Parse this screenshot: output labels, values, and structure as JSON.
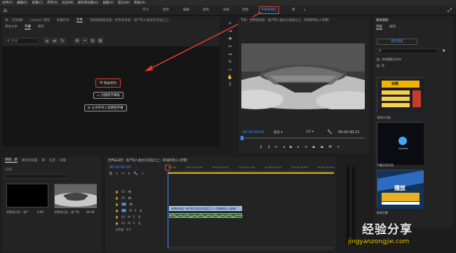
{
  "menu": [
    "文件(F)",
    "编辑(E)",
    "剪辑(C)",
    "序列(S)",
    "标记(M)",
    "图形和标题(G)",
    "视图(V)",
    "窗口(W)",
    "帮助(H)"
  ],
  "workspaces": [
    "学习",
    "组件",
    "编辑",
    "颜色",
    "效果",
    "音频",
    "字幕和图形",
    "库"
  ],
  "workspace_active": "字幕和图形",
  "source_panel": {
    "tabs": [
      "源：(无剪辑)",
      "Lumetri 范围",
      "效果控件",
      "文本",
      "音频剪辑混合器：世界末日后：丧尸的人类主在云层之上；"
    ],
    "sub_tabs": [
      "转录文本",
      "字幕",
      "图形"
    ],
    "sub_active": "字幕",
    "search_placeholder": "搜索",
    "buttons": [
      "转录序列",
      "创建新字幕轨",
      "从文件导入说明性字幕"
    ]
  },
  "program": {
    "title": "节目：世界末日后：丧尸的人类主在云层之上；可再移到让人恐惧！",
    "timecode": "00:00:00:00",
    "fit": "适合",
    "ratio": "1/2",
    "duration": "00:00:40:21"
  },
  "graphics_panel": {
    "title": "基本图形",
    "tabs": [
      "浏览",
      "编辑"
    ],
    "my_templates": "我的模板",
    "checks": [
      "本地模板文件夹",
      "库"
    ],
    "templates": [
      {
        "label": "游戏计分板",
        "thumb_text": "标题"
      },
      {
        "label": "书籍封面总结",
        "thumb_text": ""
      },
      {
        "label": "新闻字幕",
        "thumb_text": "播放"
      }
    ]
  },
  "project_panel": {
    "tabs": [
      "项目：新",
      "媒体浏览器",
      "库",
      "信息",
      "效果"
    ],
    "item_count": "(2)项",
    "items": [
      {
        "name": "世界末日后：丧尸",
        "duration": "0:00"
      },
      {
        "name": "世界末日后：丧尸的",
        "duration": "00:40"
      }
    ]
  },
  "timeline": {
    "title": "世界末日后：丧尸的人类主在云层之上；可再移到让人恐惧！",
    "timecode": "00:00:00:00",
    "ruler": [
      "00:00",
      "00:00:05:00",
      "00:00:10:00",
      "00:00:15:00",
      "00:00:20:00",
      "00:00:25:00",
      "00:00:30:00"
    ],
    "tracks": [
      "V3",
      "V2",
      "V1",
      "A1",
      "A2",
      "A3"
    ],
    "clip_label": "世界末日后：丧尸的人类主在云层之上；可再移到让人恐惧！",
    "master": "主声道",
    "master_value": "0.0"
  },
  "watermark": {
    "main": "经验分享",
    "url": "jingyanzongjie.com"
  },
  "colors": {
    "accent": "#3b8cff",
    "highlight": "#e23b2e",
    "clip": "#8fb3e6"
  }
}
